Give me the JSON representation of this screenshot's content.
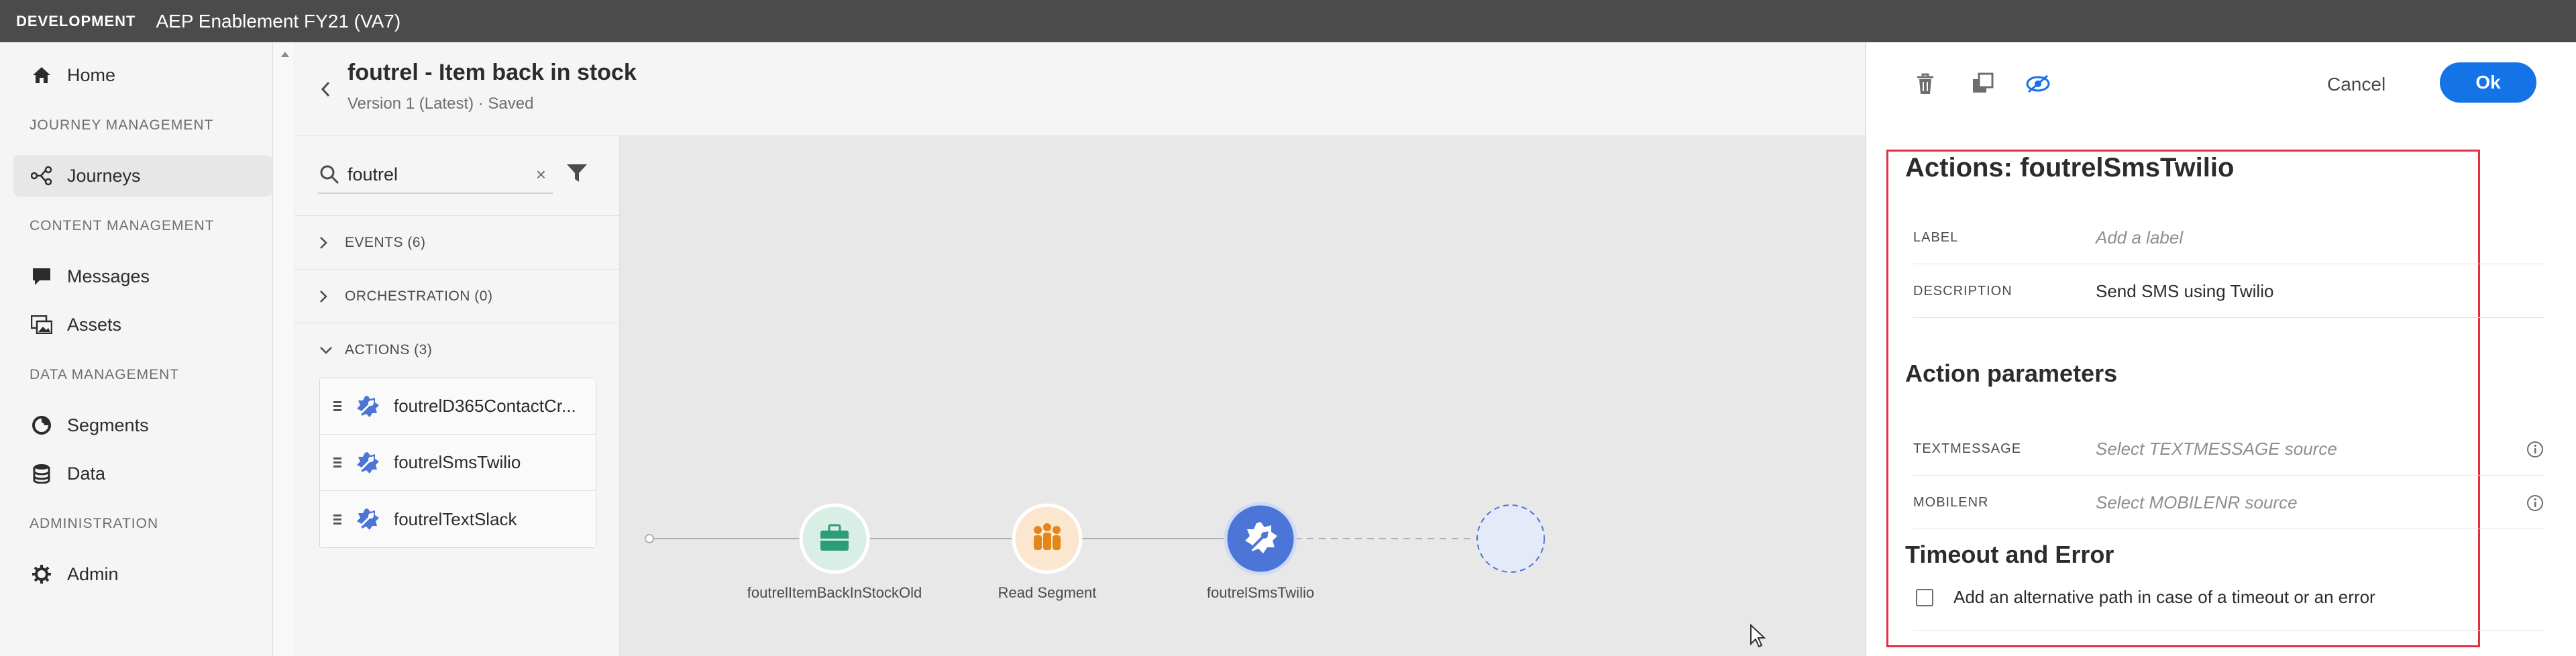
{
  "topbar": {
    "env": "DEVELOPMENT",
    "org": "AEP Enablement FY21 (VA7)"
  },
  "nav": {
    "home": "Home",
    "section_journey": "JOURNEY MANAGEMENT",
    "journeys": "Journeys",
    "section_content": "CONTENT MANAGEMENT",
    "messages": "Messages",
    "assets": "Assets",
    "section_data": "DATA MANAGEMENT",
    "segments": "Segments",
    "data": "Data",
    "section_admin": "ADMINISTRATION",
    "admin": "Admin"
  },
  "journey": {
    "title": "foutrel - Item back in stock",
    "subtitle": "Version 1 (Latest) · Saved"
  },
  "palette": {
    "search_value": "foutrel",
    "clear": "×",
    "events": "EVENTS (6)",
    "orchestration": "ORCHESTRATION (0)",
    "actions": "ACTIONS (3)",
    "action_items": [
      "foutrelD365ContactCr...",
      "foutrelSmsTwilio",
      "foutrelTextSlack"
    ]
  },
  "canvas": {
    "nodes": [
      {
        "label": "foutrelItemBackInStockOld",
        "kind": "event",
        "color": "#d9efe6",
        "icon_color": "#2d9d78"
      },
      {
        "label": "Read Segment",
        "kind": "segment",
        "color": "#fbe6cf",
        "icon_color": "#e68619"
      },
      {
        "label": "foutrelSmsTwilio",
        "kind": "action",
        "color": "#4b75d6",
        "icon_color": "#ffffff"
      },
      {
        "label": "",
        "kind": "placeholder"
      }
    ]
  },
  "panel": {
    "cancel": "Cancel",
    "ok": "Ok",
    "title": "Actions: foutrelSmsTwilio",
    "label_field": "LABEL",
    "label_placeholder": "Add a label",
    "desc_field": "DESCRIPTION",
    "desc_value": "Send SMS using Twilio",
    "params_title": "Action parameters",
    "textmessage_field": "TEXTMESSAGE",
    "textmessage_placeholder": "Select TEXTMESSAGE source",
    "mobilenr_field": "MOBILENR",
    "mobilenr_placeholder": "Select MOBILENR source",
    "timeout_title": "Timeout and Error",
    "timeout_checkbox": "Add an alternative path in case of a timeout or an error"
  },
  "colors": {
    "accent": "#1473e6",
    "highlight_box": "#e0303e",
    "topbar": "#4b4b4b"
  }
}
